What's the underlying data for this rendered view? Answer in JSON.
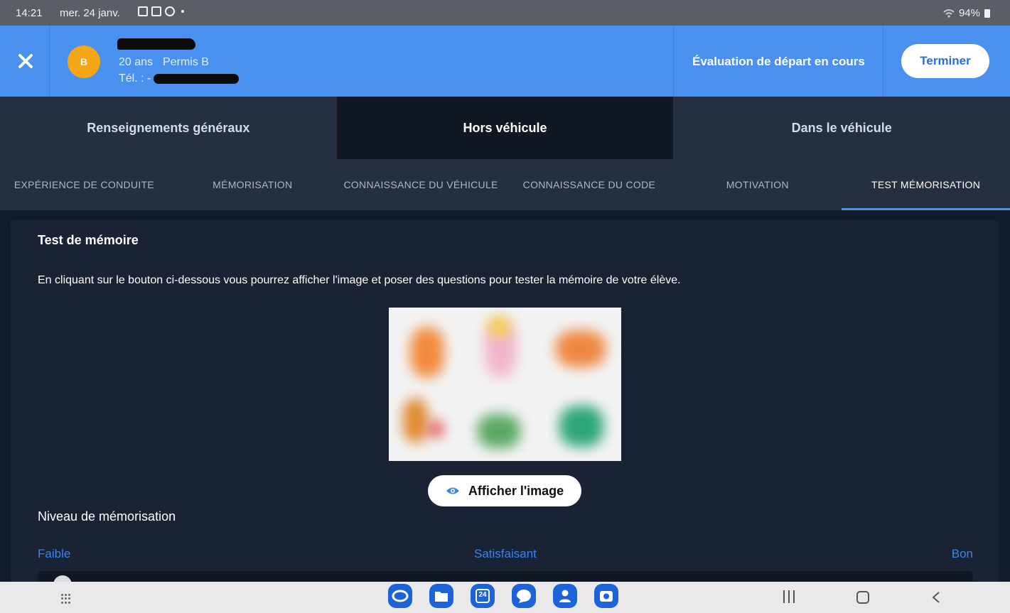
{
  "status_bar": {
    "time": "14:21",
    "date": "mer. 24 janv.",
    "battery": "94%"
  },
  "header": {
    "avatar_initial": "B",
    "age": "20 ans",
    "license": "Permis B",
    "phone_label": "Tél. : -",
    "evaluation_status": "Évaluation de départ en cours",
    "finish_label": "Terminer"
  },
  "main_tabs": [
    {
      "label": "Renseignements généraux",
      "active": false
    },
    {
      "label": "Hors véhicule",
      "active": true
    },
    {
      "label": "Dans le véhicule",
      "active": false
    }
  ],
  "sub_tabs": [
    {
      "label": "EXPÉRIENCE DE CONDUITE",
      "active": false
    },
    {
      "label": "MÉMORISATION",
      "active": false
    },
    {
      "label": "CONNAISSANCE DU VÉHICULE",
      "active": false
    },
    {
      "label": "CONNAISSANCE DU CODE",
      "active": false
    },
    {
      "label": "MOTIVATION",
      "active": false
    },
    {
      "label": "TEST MÉMORISATION",
      "active": true
    }
  ],
  "content": {
    "title": "Test de mémoire",
    "description": "En cliquant sur le bouton ci-dessous vous pourrez afficher l'image et poser des questions pour tester la mémoire de votre élève.",
    "show_image_label": "Afficher l'image",
    "level_title": "Niveau de mémorisation",
    "level_low": "Faible",
    "level_mid": "Satisfaisant",
    "level_high": "Bon"
  },
  "colors": {
    "header_blue": "#4a90ee",
    "avatar_orange": "#f4a616",
    "accent_blue": "#3d84e8",
    "background": "#121b2b"
  },
  "dock_apps": [
    "browser-icon",
    "files-icon",
    "calendar-icon",
    "messages-icon",
    "contacts-icon",
    "camera-icon"
  ],
  "calendar_day": "24"
}
